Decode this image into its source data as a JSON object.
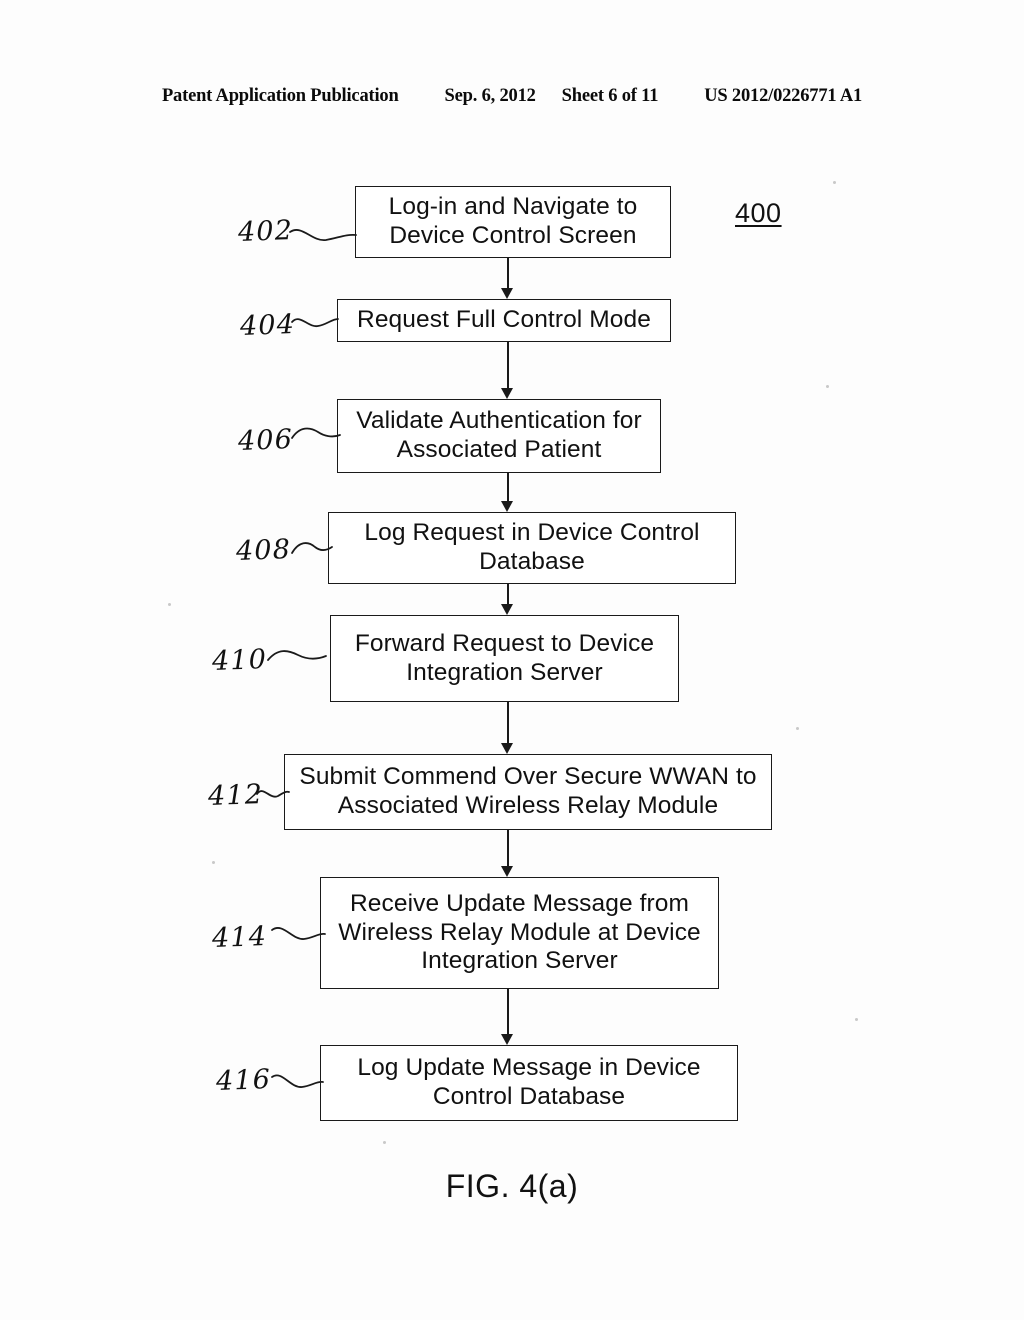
{
  "header": {
    "publication": "Patent Application Publication",
    "date": "Sep. 6, 2012",
    "sheet": "Sheet 6 of 11",
    "patent_number": "US 2012/0226771 A1"
  },
  "figure": {
    "number_label": "400",
    "caption": "FIG. 4(a)"
  },
  "flowchart": {
    "type": "flowchart",
    "orientation": "top-to-bottom",
    "steps": [
      {
        "ref": "402",
        "line1": "Log-in and Navigate to",
        "line2": "Device Control Screen",
        "text": "Log-in and Navigate to Device Control Screen"
      },
      {
        "ref": "404",
        "line1": "Request Full Control Mode",
        "line2": "",
        "text": "Request Full Control Mode"
      },
      {
        "ref": "406",
        "line1": "Validate Authentication for",
        "line2": "Associated Patient",
        "text": "Validate Authentication for Associated Patient"
      },
      {
        "ref": "408",
        "line1": "Log Request in Device Control",
        "line2": "Database",
        "text": "Log Request in Device Control Database"
      },
      {
        "ref": "410",
        "line1": "Forward Request to Device",
        "line2": "Integration Server",
        "text": "Forward Request to Device Integration Server"
      },
      {
        "ref": "412",
        "line1": "Submit Commend Over Secure WWAN to",
        "line2": "Associated Wireless Relay Module",
        "text": "Submit Commend Over Secure WWAN to Associated Wireless Relay Module"
      },
      {
        "ref": "414",
        "line1": "Receive Update Message from",
        "line2": "Wireless Relay Module at Device",
        "line3": "Integration Server",
        "text": "Receive Update Message from Wireless Relay Module at Device Integration Server"
      },
      {
        "ref": "416",
        "line1": "Log Update Message in Device",
        "line2": "Control Database",
        "text": "Log Update Message in Device Control Database"
      }
    ]
  },
  "colors": {
    "ink": "#111111",
    "paper": "#fdfdfd"
  }
}
